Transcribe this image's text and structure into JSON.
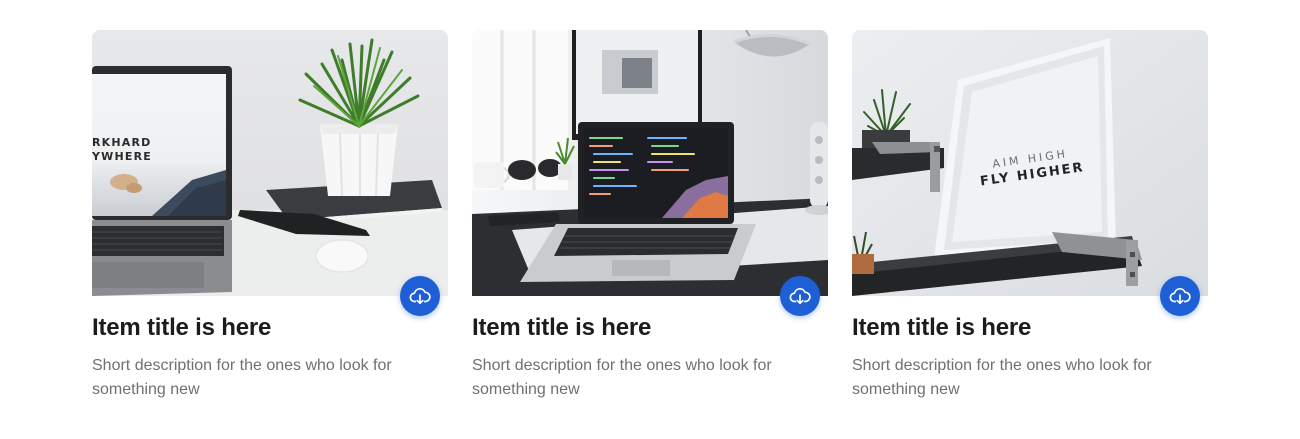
{
  "cards": [
    {
      "title": "Item title is here",
      "description": "Short description for the ones who look for something new",
      "image_icon": "laptop-plant-photo",
      "screen_text_1": "RKHARD",
      "screen_text_2": "YWHERE",
      "action_icon": "cloud-download-icon"
    },
    {
      "title": "Item title is here",
      "description": "Short description for the ones who look for something new",
      "image_icon": "laptop-code-desk-photo",
      "action_icon": "cloud-download-icon"
    },
    {
      "title": "Item title is here",
      "description": "Short description for the ones who look for something new",
      "image_icon": "framed-poster-shelf-photo",
      "poster_line_1": "AIM HIGH",
      "poster_line_2": "FLY HIGHER",
      "action_icon": "cloud-download-icon"
    }
  ],
  "colors": {
    "accent": "#1f5fd6",
    "title": "#1c1c1e",
    "description": "#707070"
  }
}
